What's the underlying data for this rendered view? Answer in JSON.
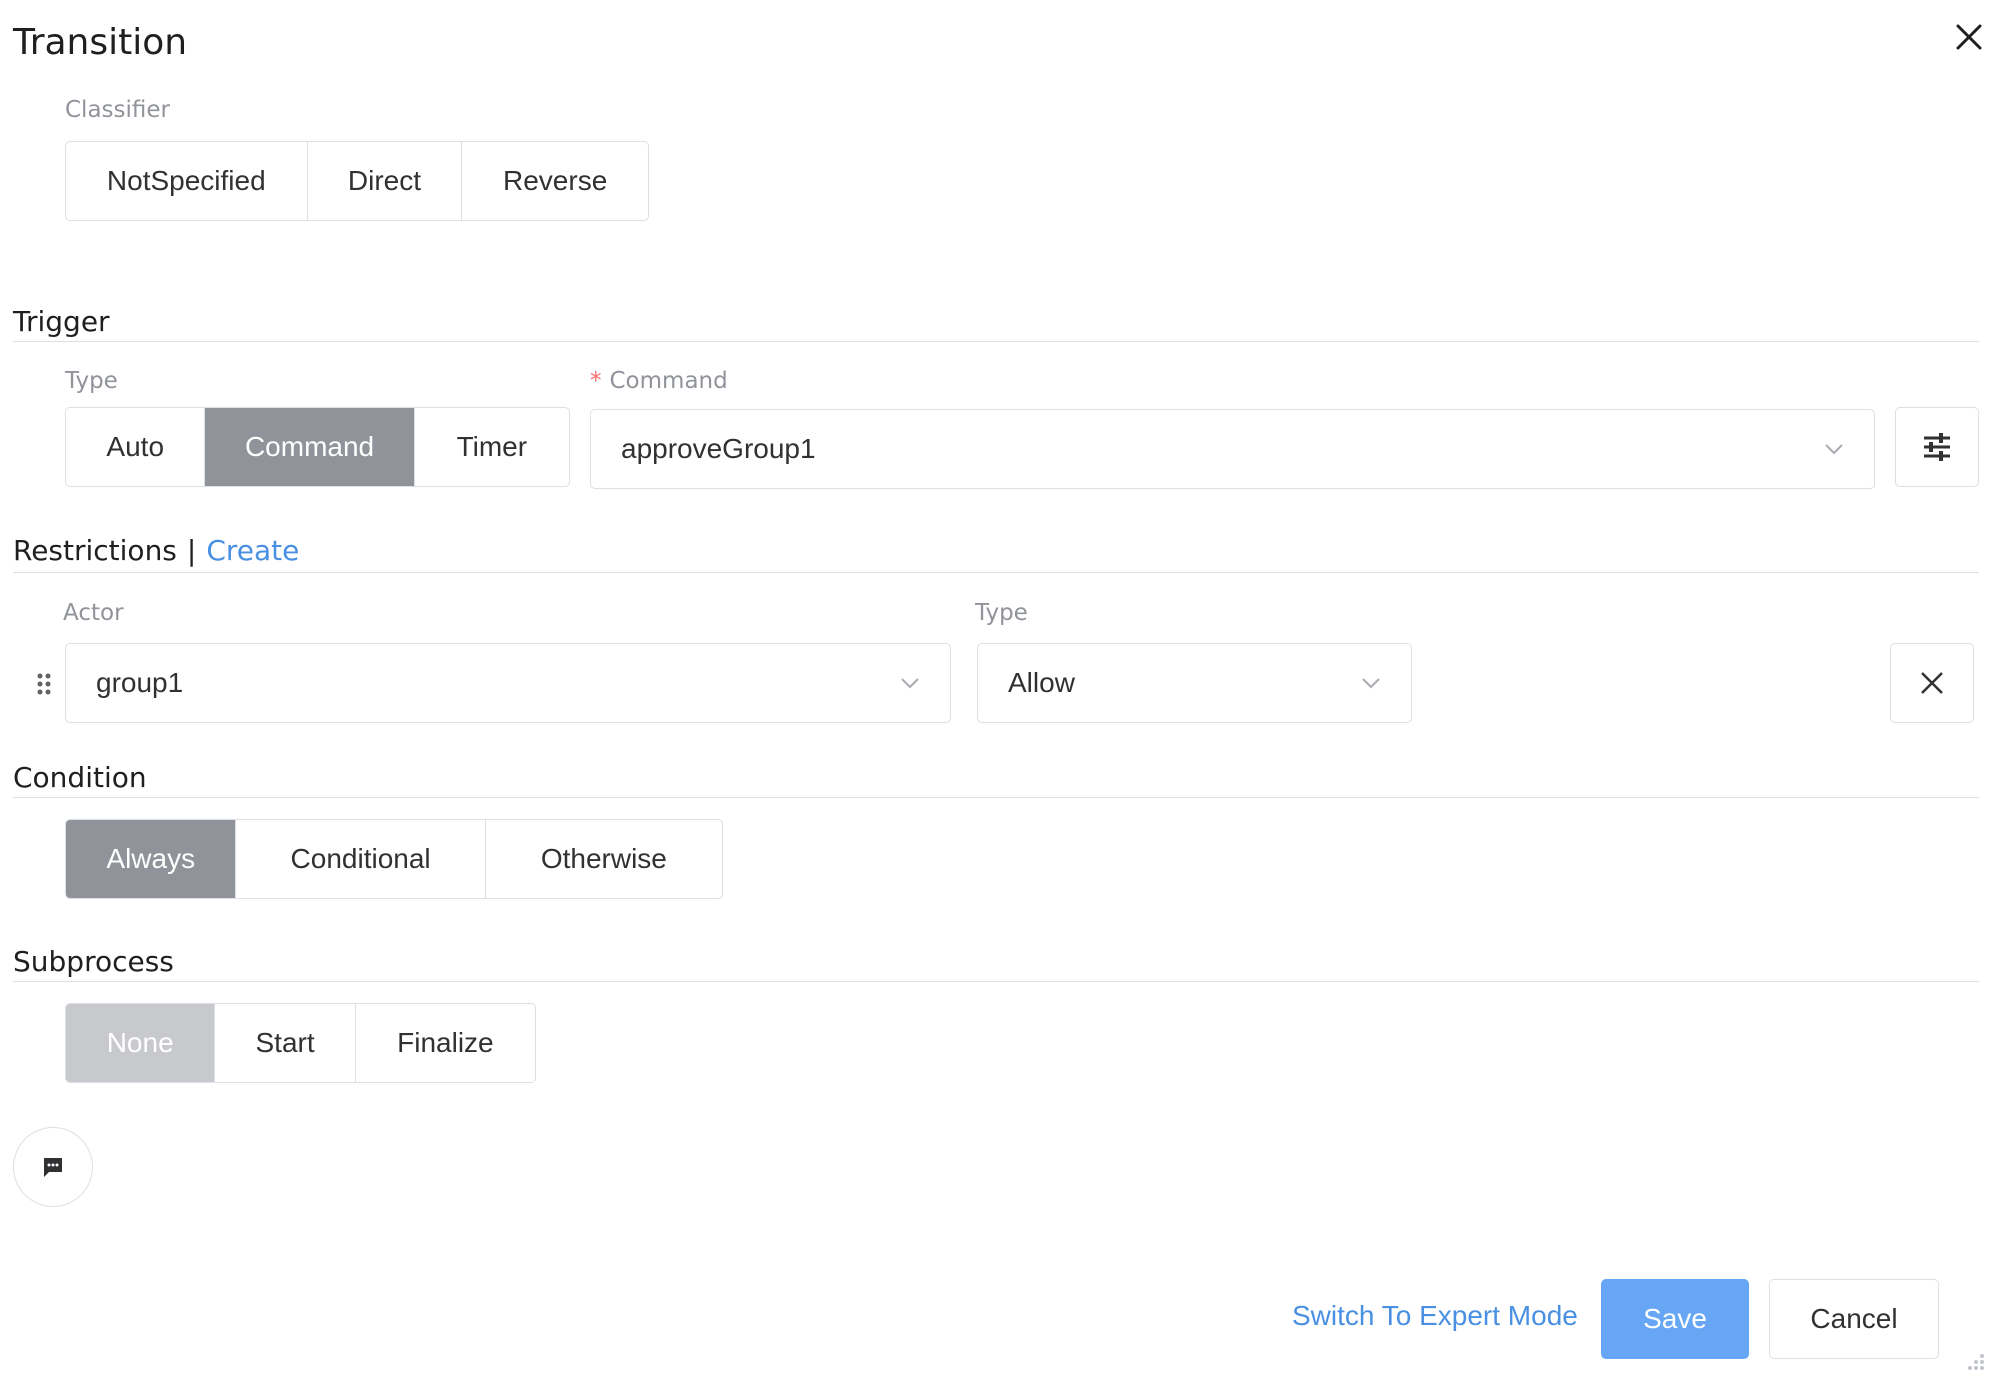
{
  "dialog": {
    "title": "Transition"
  },
  "classifier": {
    "label": "Classifier",
    "options": [
      "NotSpecified",
      "Direct",
      "Reverse"
    ],
    "selected": null
  },
  "trigger": {
    "section_title": "Trigger",
    "type_label": "Type",
    "type_options": [
      "Auto",
      "Command",
      "Timer"
    ],
    "type_selected": "Command",
    "command_required_mark": "*",
    "command_label": "Command",
    "command_value": "approveGroup1"
  },
  "restrictions": {
    "section_title": "Restrictions",
    "separator": "|",
    "create_link": "Create",
    "actor_label": "Actor",
    "type_label": "Type",
    "rows": [
      {
        "actor": "group1",
        "type": "Allow"
      }
    ]
  },
  "condition": {
    "section_title": "Condition",
    "options": [
      "Always",
      "Conditional",
      "Otherwise"
    ],
    "selected": "Always"
  },
  "subprocess": {
    "section_title": "Subprocess",
    "options": [
      "None",
      "Start",
      "Finalize"
    ],
    "selected": "None"
  },
  "footer": {
    "expert_mode": "Switch To Expert Mode",
    "save": "Save",
    "cancel": "Cancel"
  },
  "colors": {
    "accent_link": "#4a90e2",
    "save_button": "#66a6f5",
    "segment_active": "#909399",
    "segment_active_disabled": "#c8c9cc",
    "required_star": "#f56c6c"
  },
  "icons": {
    "close": "close-icon",
    "settings": "sliders-icon",
    "chevron": "chevron-down-icon",
    "drag": "drag-handle-icon",
    "remove": "remove-icon",
    "comment": "comment-icon"
  }
}
